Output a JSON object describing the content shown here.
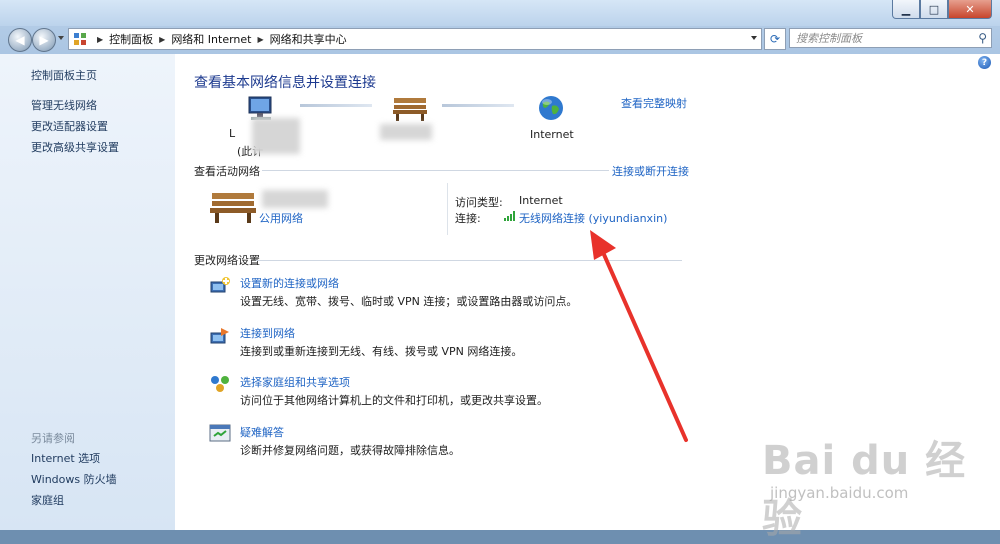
{
  "window": {
    "minimize_label": "▁",
    "maximize_label": "□",
    "close_label": "✕"
  },
  "address_bar": {
    "crumbs": [
      "控制面板",
      "网络和 Internet",
      "网络和共享中心"
    ],
    "search_placeholder": "搜索控制面板"
  },
  "sidebar": {
    "links": [
      "控制面板主页",
      "管理无线网络",
      "更改适配器设置",
      "更改高级共享设置"
    ],
    "see_also_title": "另请参阅",
    "see_also_links": [
      "Internet 选项",
      "Windows 防火墙",
      "家庭组"
    ]
  },
  "main": {
    "title": "查看基本网络信息并设置连接",
    "view_full_map": "查看完整映射",
    "map": {
      "computer_label_partial_1": "L",
      "computer_label_partial_2": "(此计",
      "internet_label": "Internet"
    },
    "active_networks": {
      "heading": "查看活动网络",
      "connect_disconnect": "连接或断开连接",
      "network_type": "公用网络",
      "access_type_label": "访问类型:",
      "access_type_value": "Internet",
      "connection_label": "连接:",
      "connection_value": "无线网络连接 (yiyundianxin)"
    },
    "change_settings": {
      "heading": "更改网络设置",
      "tasks": [
        {
          "link": "设置新的连接或网络",
          "desc": "设置无线、宽带、拨号、临时或 VPN 连接；或设置路由器或访问点。"
        },
        {
          "link": "连接到网络",
          "desc": "连接到或重新连接到无线、有线、拨号或 VPN 网络连接。"
        },
        {
          "link": "选择家庭组和共享选项",
          "desc": "访问位于其他网络计算机上的文件和打印机，或更改共享设置。"
        },
        {
          "link": "疑难解答",
          "desc": "诊断并修复网络问题，或获得故障排除信息。"
        }
      ]
    }
  },
  "watermark": {
    "brand": "Bai du 经验",
    "url": "jingyan.baidu.com"
  },
  "colors": {
    "link": "#1f64c4",
    "title": "#1d3a8f",
    "annotation_arrow": "#e8322b"
  },
  "icons": [
    "back-arrow-icon",
    "forward-arrow-icon",
    "control-panel-icon",
    "refresh-icon",
    "search-icon",
    "help-icon",
    "computer-icon",
    "bench-icon",
    "globe-icon",
    "signal-bars-icon",
    "new-connection-icon",
    "connect-network-icon",
    "homegroup-icon",
    "troubleshoot-icon"
  ]
}
